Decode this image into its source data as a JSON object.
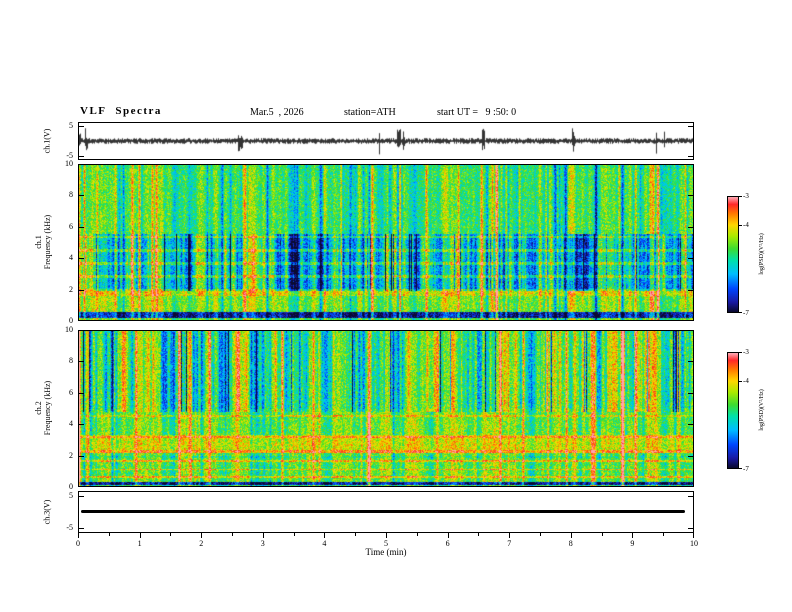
{
  "header": {
    "title": "VLF Spectra",
    "date": "Mar.5  , 2026",
    "station": "station=ATH",
    "start_ut": "start UT =   9 :50: 0"
  },
  "xaxis": {
    "label": "Time (min)",
    "range": [
      0,
      10
    ],
    "ticks": [
      "0",
      "1",
      "2",
      "3",
      "4",
      "5",
      "6",
      "7",
      "8",
      "9",
      "10"
    ]
  },
  "panels": [
    {
      "id": "ch1_wave",
      "ylabel": "ch.1(V)",
      "ylim": [
        -5,
        5
      ],
      "yticks": [
        {
          "label": "5",
          "frac": 0.115
        },
        {
          "label": "-5",
          "frac": 0.885
        }
      ]
    },
    {
      "id": "ch1_spec",
      "ylabel_lines": [
        "ch.1",
        "Frequency (kHz)"
      ],
      "ylim": [
        0,
        10
      ],
      "yticks": [
        {
          "label": "10",
          "frac": 0
        },
        {
          "label": "8",
          "frac": 0.2
        },
        {
          "label": "6",
          "frac": 0.4
        },
        {
          "label": "4",
          "frac": 0.6
        },
        {
          "label": "2",
          "frac": 0.8
        },
        {
          "label": "0",
          "frac": 1
        }
      ]
    },
    {
      "id": "ch2_spec",
      "ylabel_lines": [
        "ch.2",
        "Frequency (kHz)"
      ],
      "ylim": [
        0,
        10
      ],
      "yticks": [
        {
          "label": "10",
          "frac": 0
        },
        {
          "label": "8",
          "frac": 0.2
        },
        {
          "label": "6",
          "frac": 0.4
        },
        {
          "label": "4",
          "frac": 0.6
        },
        {
          "label": "2",
          "frac": 0.8
        },
        {
          "label": "0",
          "frac": 1
        }
      ]
    },
    {
      "id": "ch3_wave",
      "ylabel": "ch.3(V)",
      "ylim": [
        -5,
        5
      ],
      "yticks": [
        {
          "label": "5",
          "frac": 0.115
        },
        {
          "label": "-5",
          "frac": 0.885
        }
      ]
    }
  ],
  "colorbars": [
    {
      "id": "cb1",
      "label": "log(PSD)(V²/Hz)",
      "range": [
        -7,
        -3
      ],
      "ticks": [
        {
          "label": "-3",
          "frac": 0
        },
        {
          "label": "-4",
          "frac": 0.25
        },
        {
          "label": "-7",
          "frac": 1
        }
      ]
    },
    {
      "id": "cb2",
      "label": "log(PSD)(V²/Hz)",
      "range": [
        -7,
        -3
      ],
      "ticks": [
        {
          "label": "-3",
          "frac": 0
        },
        {
          "label": "-4",
          "frac": 0.25
        },
        {
          "label": "-7",
          "frac": 1
        }
      ]
    }
  ],
  "chart_data": [
    {
      "type": "line",
      "panel": "ch.1(V) time series",
      "xlabel": "Time (min)",
      "xlim": [
        0,
        10
      ],
      "ylabel": "ch.1(V)",
      "ylim": [
        -5,
        5
      ],
      "summary": "dense broadband noise trace centered on 0 V with frequent impulsive spikes reaching roughly ±5 V throughout the 10-minute record"
    },
    {
      "type": "heatmap",
      "panel": "ch.1 spectrogram",
      "xlabel": "Time (min)",
      "xlim": [
        0,
        10
      ],
      "ylabel": "Frequency (kHz)",
      "ylim": [
        0,
        10
      ],
      "zlabel": "log(PSD)(V²/Hz)",
      "zlim": [
        -7,
        -3
      ],
      "summary": "green mid-level background near -5 with many narrow vertical broadband bursts reaching -3 (red), a depressed blue band near -6.5 between about 2 and 5.5 kHz crossed by horizontal green rows, enhanced yellow power below about 1.8 kHz, and a near-black line close to -7 just above 0 kHz"
    },
    {
      "type": "heatmap",
      "panel": "ch.2 spectrogram",
      "xlabel": "Time (min)",
      "xlim": [
        0,
        10
      ],
      "ylabel": "Frequency (kHz)",
      "ylim": [
        0,
        10
      ],
      "zlabel": "log(PSD)(V²/Hz)",
      "zlim": [
        -7,
        -3
      ],
      "summary": "yellow-green background with vertical red burst streaks spanning all frequencies, a strong yellow-red band near -3.5 between about 2.2 and 3.3 kHz, thin red horizontal lines below 2 kHz, blue patches near -6.5 above about 5 kHz, and a near-black line just above 0 kHz"
    },
    {
      "type": "line",
      "panel": "ch.3(V) time series",
      "xlabel": "Time (min)",
      "xlim": [
        0,
        10
      ],
      "ylabel": "ch.3(V)",
      "ylim": [
        -5,
        5
      ],
      "values_constant": 0,
      "summary": "flat constant line at 0 V (no signal) across the whole record"
    }
  ]
}
